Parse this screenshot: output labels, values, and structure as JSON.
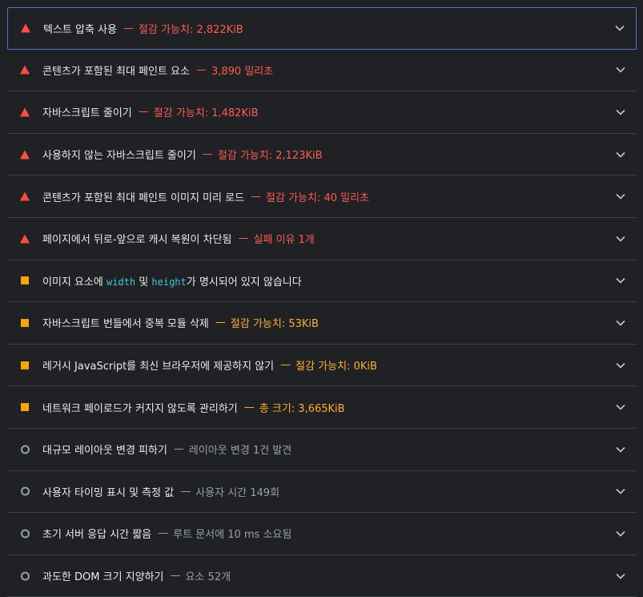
{
  "colors": {
    "fail": "#ff4e42",
    "average": "#ffa400",
    "informative": "#9aa0a6",
    "code": "#3ec6e0",
    "focus_border": "#4f73d9"
  },
  "audits": [
    {
      "status": "fail",
      "icon": "warning-triangle-icon",
      "title": "텍스트 압축 사용",
      "separator": "—",
      "display": "절감 가능치: 2,822KiB"
    },
    {
      "status": "fail",
      "icon": "warning-triangle-icon",
      "title": "콘텐츠가 포함된 최대 페인트 요소",
      "separator": "—",
      "display": "3,890 밀리초"
    },
    {
      "status": "fail",
      "icon": "warning-triangle-icon",
      "title": "자바스크립트 줄이기",
      "separator": "—",
      "display": "절감 가능치: 1,482KiB"
    },
    {
      "status": "fail",
      "icon": "warning-triangle-icon",
      "title": "사용하지 않는 자바스크립트 줄이기",
      "separator": "—",
      "display": "절감 가능치: 2,123KiB"
    },
    {
      "status": "fail",
      "icon": "warning-triangle-icon",
      "title": "콘텐츠가 포함된 최대 페인트 이미지 미리 로드",
      "separator": "—",
      "display": "절감 가능치: 40 밀리초"
    },
    {
      "status": "fail",
      "icon": "warning-triangle-icon",
      "title": "페이지에서 뒤로-앞으로 캐시 복원이 차단됨",
      "separator": "—",
      "display": "실패 이유 1개"
    },
    {
      "status": "average",
      "icon": "orange-square-icon",
      "title_parts": [
        "이미지 요소에 ",
        "width",
        " 및 ",
        "height",
        "가 명시되어 있지 않습니다"
      ],
      "separator": "",
      "display": ""
    },
    {
      "status": "average",
      "icon": "orange-square-icon",
      "title": "자바스크립트 번들에서 중복 모듈 삭제",
      "separator": "—",
      "display": "절감 가능치: 53KiB"
    },
    {
      "status": "average",
      "icon": "orange-square-icon",
      "title": "레거시 JavaScript를 최신 브라우저에 제공하지 않기",
      "separator": "—",
      "display": "절감 가능치: 0KiB"
    },
    {
      "status": "average",
      "icon": "orange-square-icon",
      "title": "네트워크 페이로드가 커지지 않도록 관리하기",
      "separator": "—",
      "display": "총 크기: 3,665KiB"
    },
    {
      "status": "informative",
      "icon": "gray-circle-icon",
      "title": "대규모 레이아웃 변경 피하기",
      "separator": "—",
      "display": "레이아웃 변경 1건 발견"
    },
    {
      "status": "informative",
      "icon": "gray-circle-icon",
      "title": "사용자 타이밍 표시 및 측정 값",
      "separator": "—",
      "display": "사용자 시간 149회"
    },
    {
      "status": "informative",
      "icon": "gray-circle-icon",
      "title": "초기 서버 응답 시간 짧음",
      "separator": "—",
      "display": "루트 문서에 10 ms 소요됨"
    },
    {
      "status": "informative",
      "icon": "gray-circle-icon",
      "title": "과도한 DOM 크기 지양하기",
      "separator": "—",
      "display": "요소 52개"
    }
  ]
}
